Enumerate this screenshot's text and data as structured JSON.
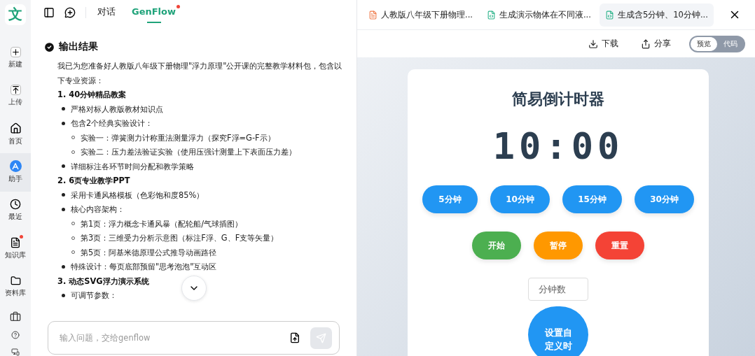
{
  "sidebar": {
    "logo": "文",
    "items": [
      {
        "label": "新建",
        "selected": false,
        "dot": false
      },
      {
        "label": "上传",
        "selected": false,
        "dot": false
      },
      {
        "label": "首页",
        "selected": false,
        "dot": false
      },
      {
        "label": "助手",
        "selected": true,
        "dot": false
      },
      {
        "label": "最近",
        "selected": false,
        "dot": false
      },
      {
        "label": "知识库",
        "selected": false,
        "dot": true
      },
      {
        "label": "资料库",
        "selected": false,
        "dot": false
      }
    ]
  },
  "chat": {
    "tabs": [
      {
        "label": "对话",
        "selected": false,
        "dot": false
      },
      {
        "label": "GenFlow",
        "selected": true,
        "dot": true
      }
    ],
    "result_title": "输出结果",
    "intro": "我已为您准备好人教版八年级下册物理\"浮力原理\"公开课的完整教学材料包，包含以下专业资源：",
    "sections": [
      {
        "title": "1. 40分钟精品教案",
        "items": [
          {
            "text": "严格对标人教版教材知识点"
          },
          {
            "text": "包含2个经典实验设计：",
            "children": [
              {
                "text": "实验一：弹簧测力计称重法测量浮力（探究F浮=G-F示）"
              },
              {
                "text": "实验二：压力差法验证实验（使用压强计测量上下表面压力差）"
              }
            ]
          },
          {
            "text": "详细标注各环节时间分配和教学策略"
          }
        ]
      },
      {
        "title": "2. 6页专业教学PPT",
        "items": [
          {
            "text": "采用卡通风格模板（色彩饱和度85%）"
          },
          {
            "text": "核心内容架构：",
            "children": [
              {
                "text": "第1页：浮力概念卡通风暴（配轮船/气球插图）"
              },
              {
                "text": "第3页：三维受力分析示意图（标注F浮、G、F支等矢量）"
              },
              {
                "text": "第5页：阿基米德原理公式推导动画路径"
              }
            ]
          },
          {
            "text": "特殊设计：每页底部预留\"思考泡泡\"互动区"
          }
        ]
      },
      {
        "title": "3. 动态SVG浮力演示系统",
        "items": [
          {
            "text": "可调节参数："
          }
        ]
      }
    ],
    "input": {
      "placeholder": "输入问题，交给genflow"
    }
  },
  "preview": {
    "tabs": [
      {
        "label": "人教版八年级下册物理...",
        "kind": "ppt",
        "selected": false
      },
      {
        "label": "生成演示物体在不同液...",
        "kind": "code",
        "selected": false
      },
      {
        "label": "生成含5分钟、10分钟...",
        "kind": "code",
        "selected": true
      }
    ],
    "actions": [
      "下载",
      "分享"
    ],
    "mode": [
      {
        "label": "预览",
        "selected": true
      },
      {
        "label": "代码",
        "selected": false
      }
    ],
    "timer": {
      "title": "简易倒计时器",
      "time": "10:00",
      "presets": [
        "5分钟",
        "10分钟",
        "15分钟",
        "30分钟"
      ],
      "controls": [
        {
          "label": "开始",
          "color": "#4caf50"
        },
        {
          "label": "暂停",
          "color": "#ff9800"
        },
        {
          "label": "重置",
          "color": "#f44336"
        }
      ],
      "minutes_placeholder": "分钟数",
      "custom_button": "设置自定义时"
    }
  }
}
